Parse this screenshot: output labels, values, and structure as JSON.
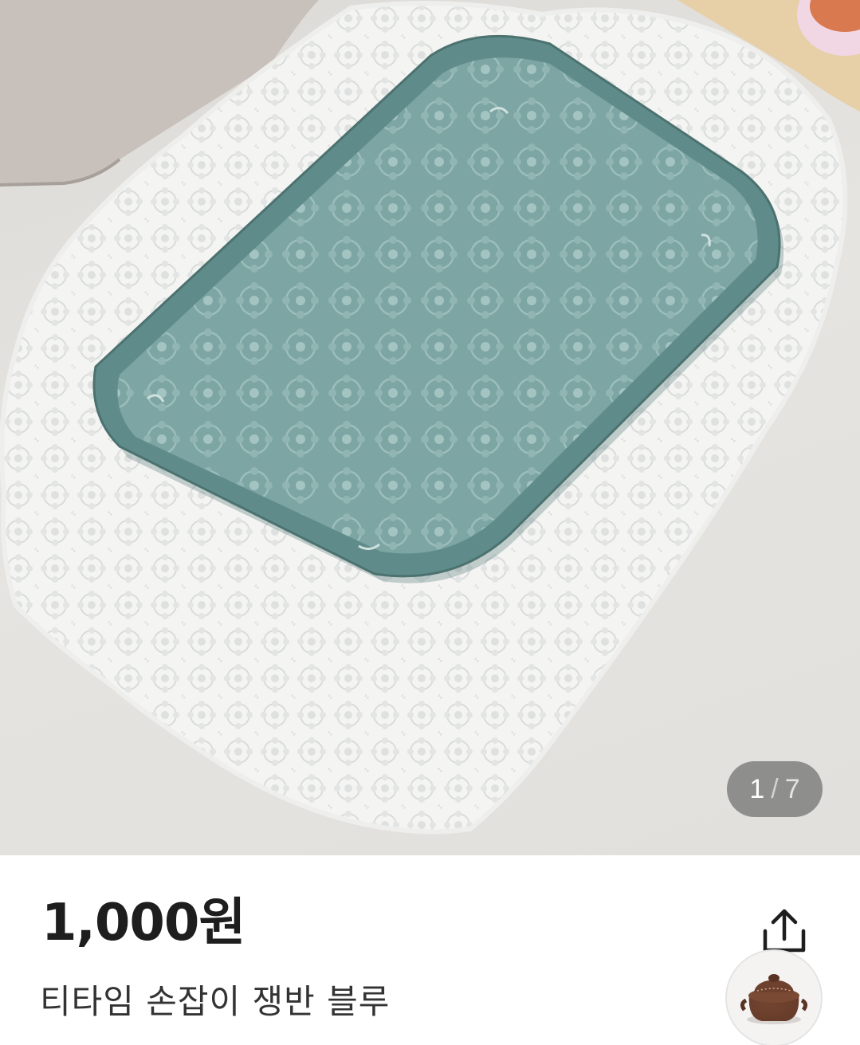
{
  "product": {
    "price": "1,000원",
    "name": "티타임 손잡이 쟁반 블루"
  },
  "gallery": {
    "current": "1",
    "separator": "/",
    "total": "7"
  },
  "icons": {
    "share": "share-icon",
    "recent_item": "clay-pot-thumbnail"
  },
  "colors": {
    "tray": "#6f9c9a",
    "price_text": "#1e1e1e",
    "counter_bg": "#6e6e6e"
  }
}
